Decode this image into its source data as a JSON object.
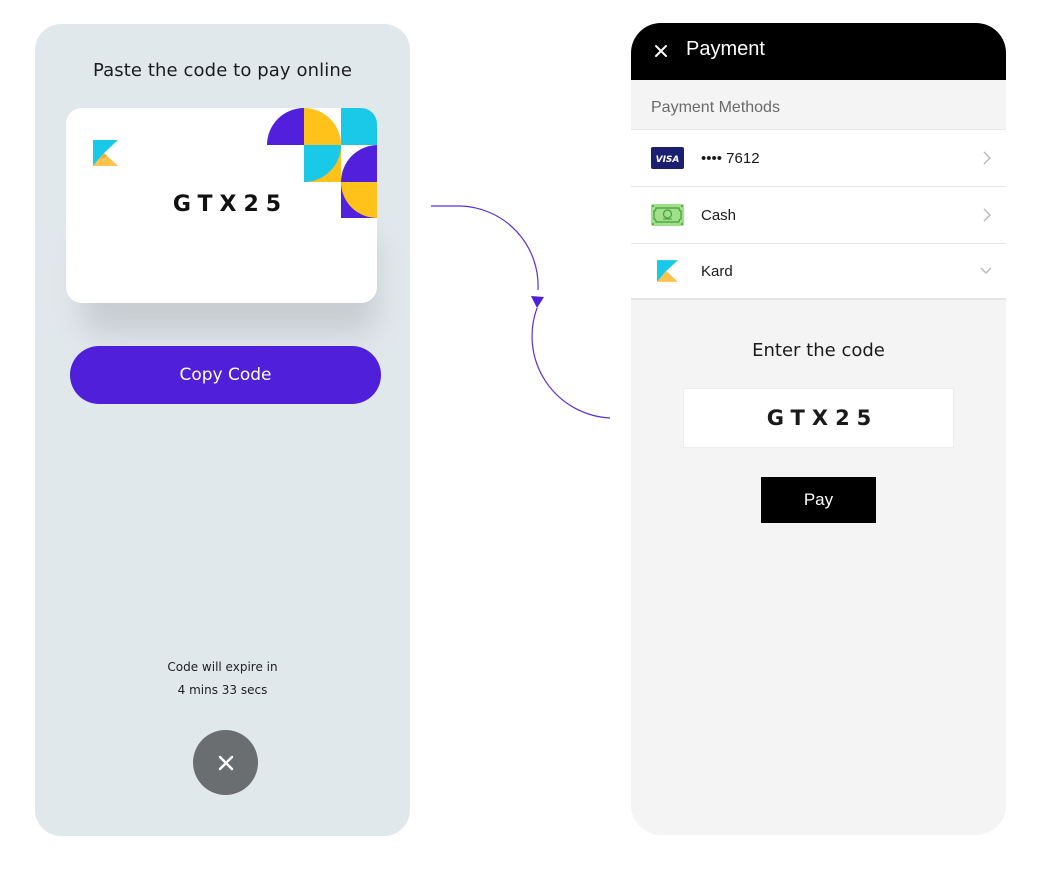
{
  "colors": {
    "brand_purple": "#4f1fd9",
    "kard_cyan": "#1ac8e8",
    "kard_yellow": "#ffc21a",
    "left_bg": "#e1e8ec",
    "right_bg": "#f4f4f4",
    "header_bg": "#000000"
  },
  "left_screen": {
    "title": "Paste the code to pay online",
    "card": {
      "logo_icon": "kard-logo-icon",
      "code": "GTX25"
    },
    "copy_button_label": "Copy Code",
    "expire_line1": "Code will expire in",
    "expire_line2": "4 mins 33 secs",
    "close_icon": "close-icon"
  },
  "right_screen": {
    "header": {
      "close_icon": "close-icon",
      "title": "Payment"
    },
    "section_title": "Payment Methods",
    "methods": [
      {
        "icon": "visa-card-icon",
        "label": "•••• 7612",
        "chevron": "chevron-right-icon"
      },
      {
        "icon": "cash-icon",
        "label": "Cash",
        "chevron": "chevron-right-icon"
      },
      {
        "icon": "kard-logo-icon",
        "label": "Kard",
        "chevron": "chevron-down-icon"
      }
    ],
    "enter_code_label": "Enter the code",
    "code_input_value": "GTX25",
    "pay_button_label": "Pay"
  }
}
